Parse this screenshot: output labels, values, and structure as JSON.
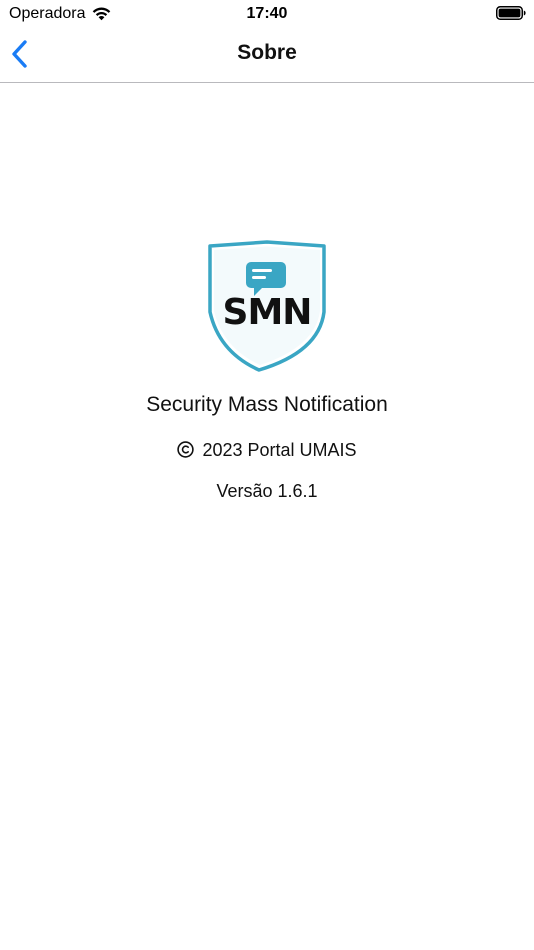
{
  "status_bar": {
    "carrier": "Operadora",
    "time": "17:40",
    "wifi_icon": "wifi-icon",
    "battery_icon": "battery-icon"
  },
  "nav": {
    "back_icon": "chevron-left-icon",
    "title": "Sobre"
  },
  "about": {
    "logo_text": "SMN",
    "logo_icon": "shield-chat-logo",
    "app_name": "Security Mass Notification",
    "copyright_icon": "copyright-icon",
    "copyright": "2023 Portal UMAIS",
    "version": "Versão 1.6.1"
  },
  "colors": {
    "accent": "#1a7cf5",
    "logo_teal": "#3aa6c4",
    "logo_shield_fill": "#e8f5f9"
  }
}
